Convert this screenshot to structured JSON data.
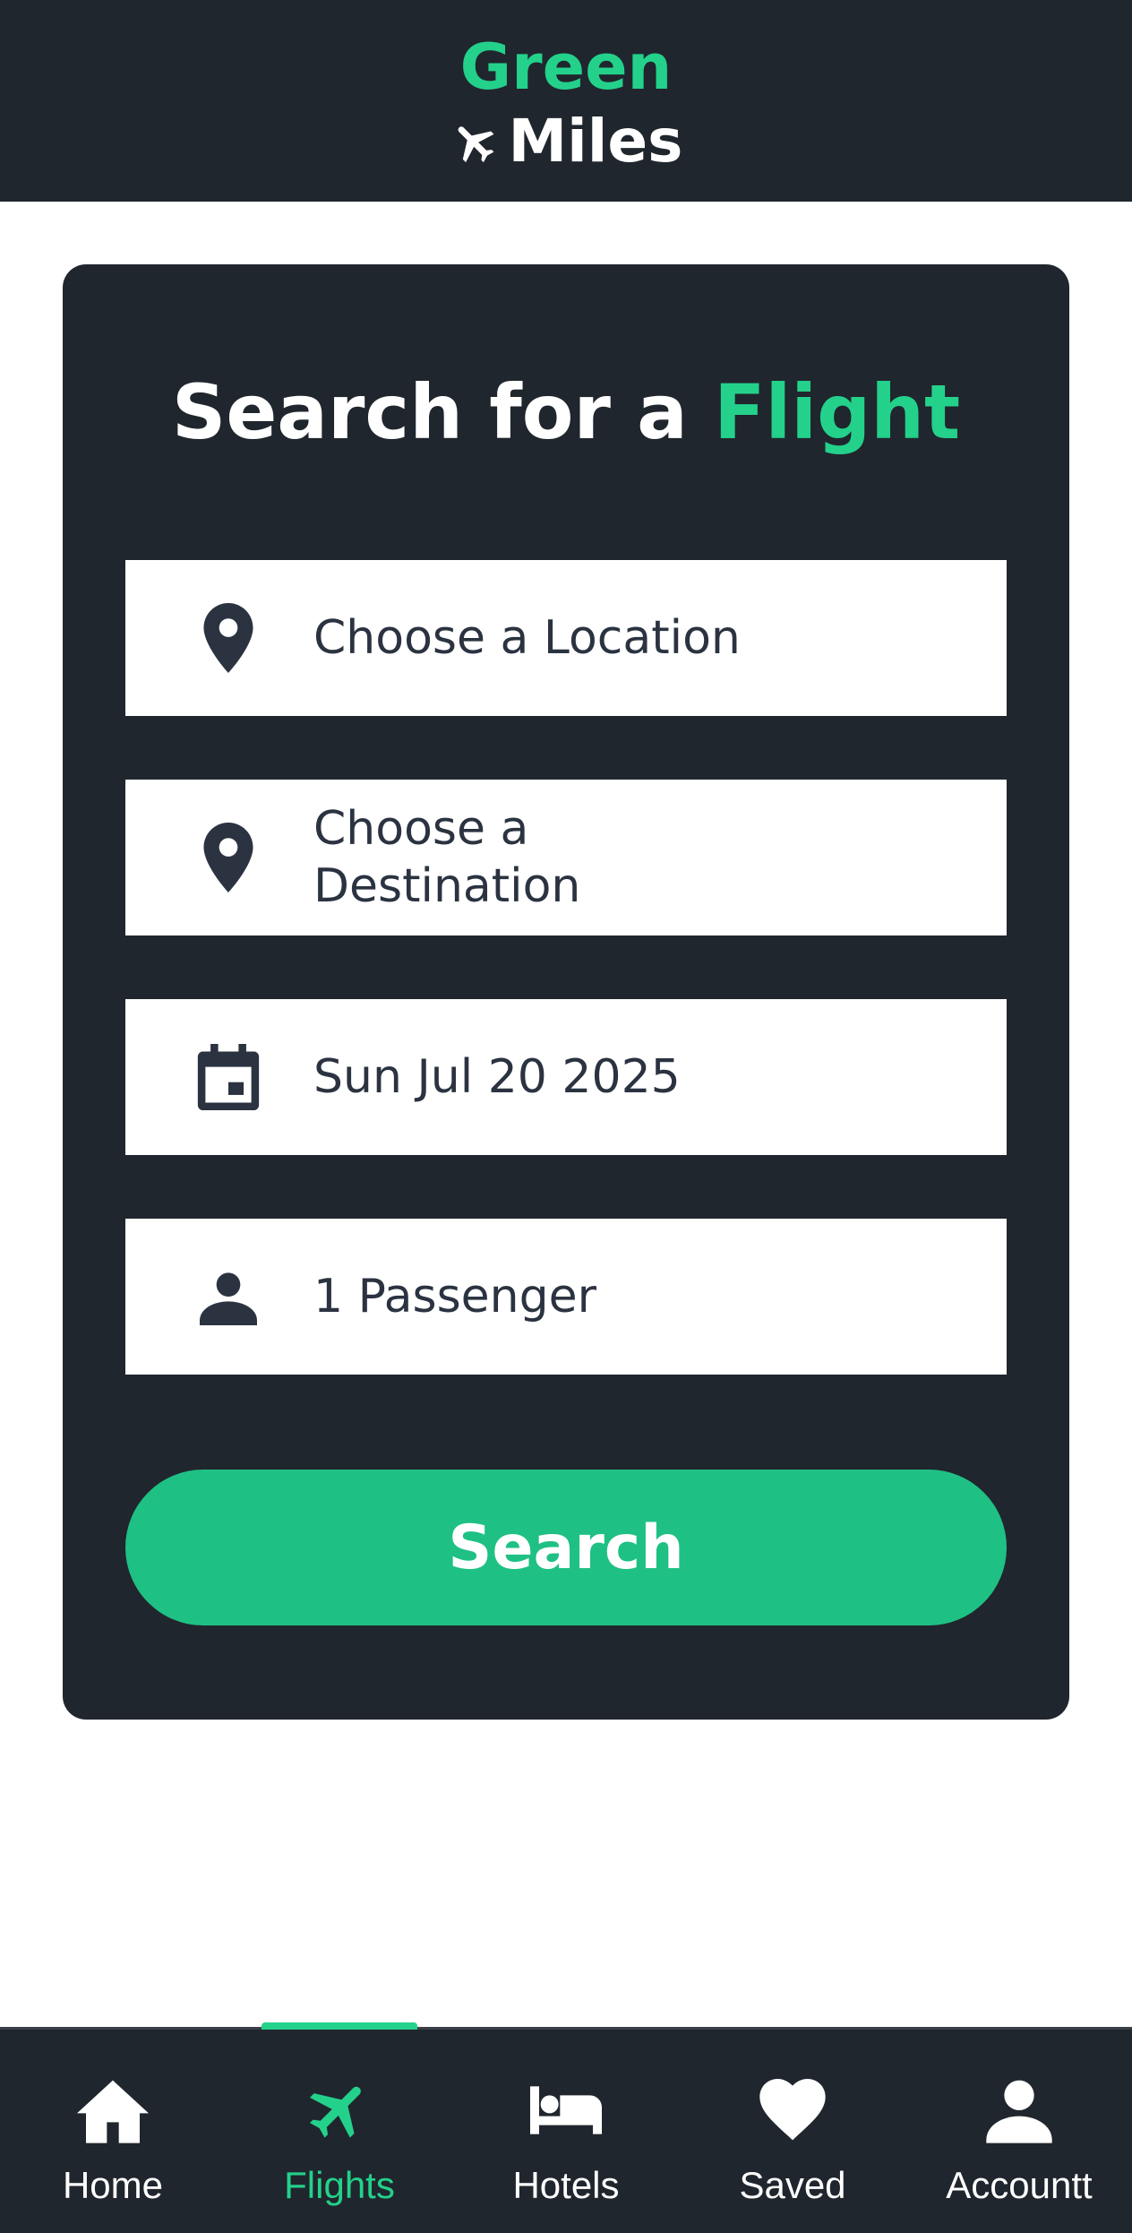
{
  "header": {
    "brand_top": "Green",
    "brand_bottom": "Miles",
    "brand_icon": "airplane-icon"
  },
  "search_card": {
    "title_prefix": "Search for a",
    "title_accent": "Flight",
    "fields": [
      {
        "icon": "location-pin-icon",
        "value": "Choose a Location"
      },
      {
        "icon": "location-pin-icon",
        "value": "Choose a Destination"
      },
      {
        "icon": "calendar-icon",
        "value": "Sun Jul 20 2025"
      },
      {
        "icon": "person-icon",
        "value": "1 Passenger"
      }
    ],
    "search_label": "Search"
  },
  "bottom_nav": {
    "active": "Flights",
    "items": [
      {
        "icon": "home-icon",
        "label": "Home"
      },
      {
        "icon": "airplane-icon",
        "label": "Flights"
      },
      {
        "icon": "bed-icon",
        "label": "Hotels"
      },
      {
        "icon": "heart-icon",
        "label": "Saved"
      },
      {
        "icon": "user-icon",
        "label": "Accountt"
      }
    ]
  },
  "colors": {
    "dark": "#20262d",
    "accent": "#23d18b",
    "button": "#1fc084",
    "field_text": "#2b3341"
  }
}
